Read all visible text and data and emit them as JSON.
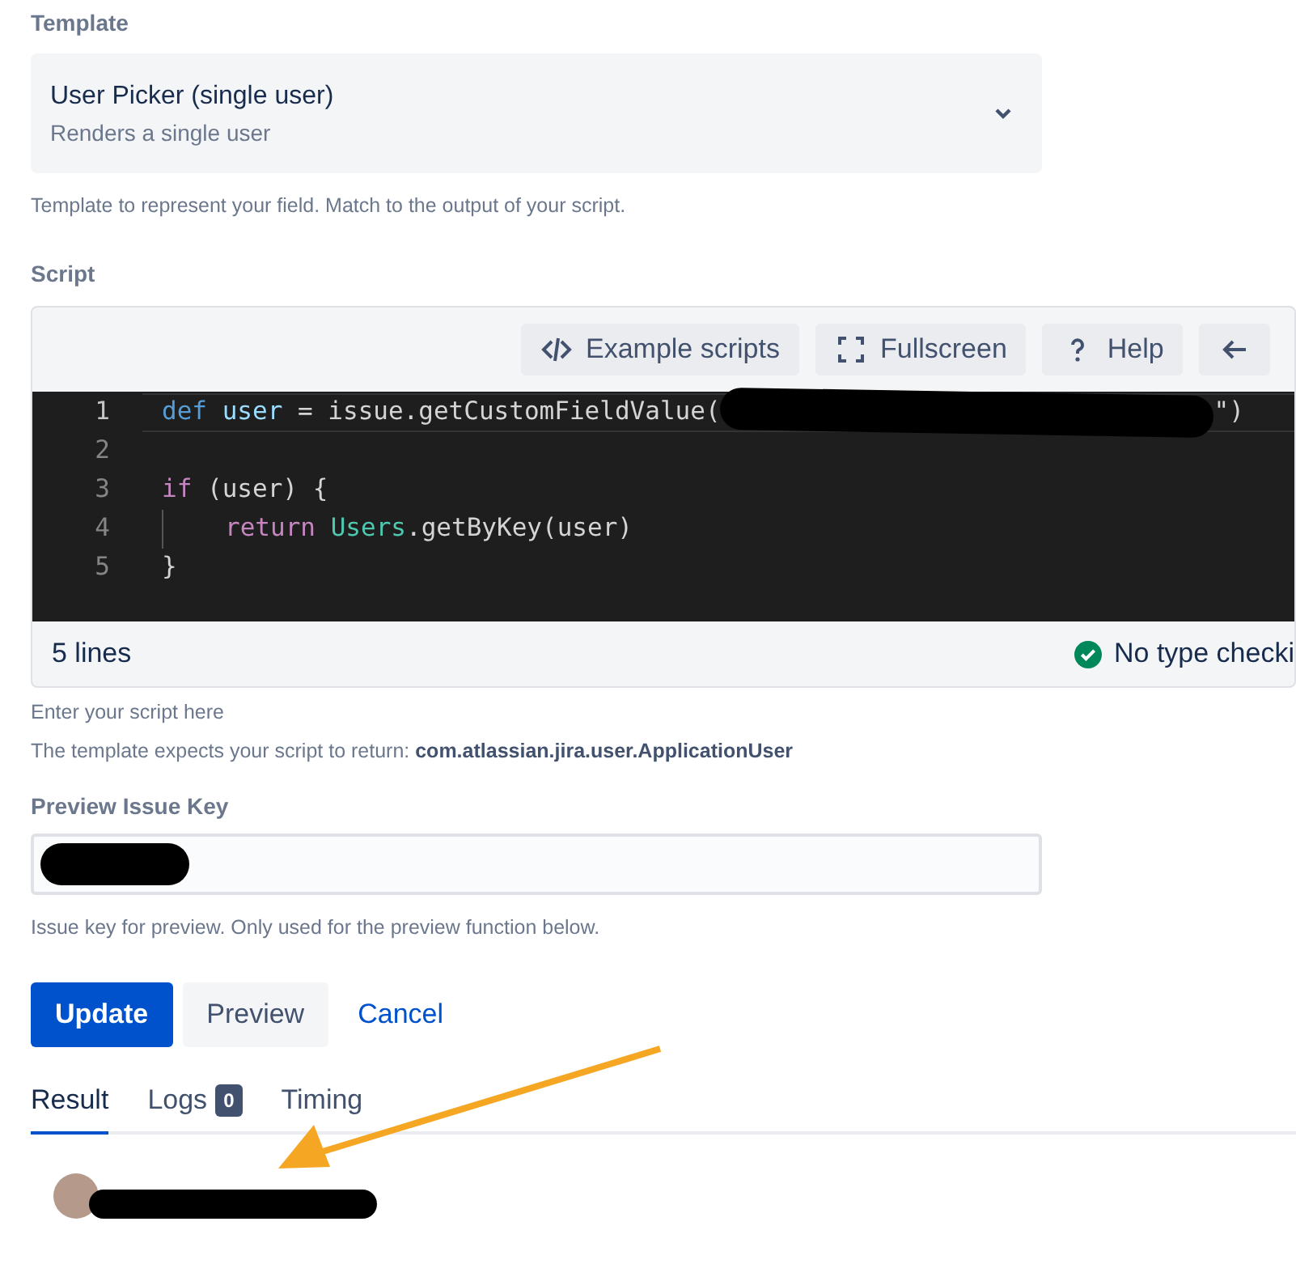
{
  "template": {
    "label": "Template",
    "value": "User Picker (single user)",
    "description": "Renders a single user",
    "help": "Template to represent your field. Match to the output of your script."
  },
  "script": {
    "label": "Script",
    "toolbar": [
      {
        "kind": "code",
        "label": "Example scripts"
      },
      {
        "kind": "fullscreen",
        "label": "Fullscreen"
      },
      {
        "kind": "help",
        "label": "Help"
      },
      {
        "kind": "back"
      }
    ],
    "lines": [
      {
        "number": "1",
        "active": true,
        "indent": false,
        "tokens": [
          {
            "kind": "keyword",
            "text": "def "
          },
          {
            "kind": "variable",
            "text": "user"
          },
          {
            "kind": "plain",
            "text": " = issue.getCustomFieldValue("
          },
          {
            "kind": "redaction"
          },
          {
            "kind": "plain",
            "text": "\")"
          }
        ]
      },
      {
        "number": "2",
        "active": false,
        "indent": false
      },
      {
        "number": "3",
        "active": false,
        "indent": false,
        "tokens": [
          {
            "kind": "control",
            "text": "if"
          },
          {
            "kind": "plain",
            "text": " (user) {"
          }
        ]
      },
      {
        "number": "4",
        "active": false,
        "indent": true,
        "tokens": [
          {
            "kind": "control",
            "text": "return "
          },
          {
            "kind": "class",
            "text": "Users"
          },
          {
            "kind": "plain",
            "text": ".getByKey(user)"
          }
        ]
      },
      {
        "number": "5",
        "active": false,
        "indent": false,
        "tokens": [
          {
            "kind": "plain",
            "text": "}"
          }
        ]
      }
    ],
    "status_left": "5 lines",
    "status_right": "No type checki",
    "help": "Enter your script here",
    "return_prefix": "The template expects your script to return: ",
    "return_type": "com.atlassian.jira.user.ApplicationUser"
  },
  "preview": {
    "label": "Preview Issue Key",
    "help": "Issue key for preview. Only used for the preview function below."
  },
  "buttons": [
    {
      "kind": "primary",
      "label": "Update"
    },
    {
      "kind": "secondary",
      "label": "Preview"
    },
    {
      "kind": "link",
      "label": "Cancel"
    }
  ],
  "tabs": [
    {
      "label": "Result",
      "selected": true
    },
    {
      "label": "Logs",
      "selected": false,
      "badge": "0"
    },
    {
      "label": "Timing",
      "selected": false
    }
  ]
}
